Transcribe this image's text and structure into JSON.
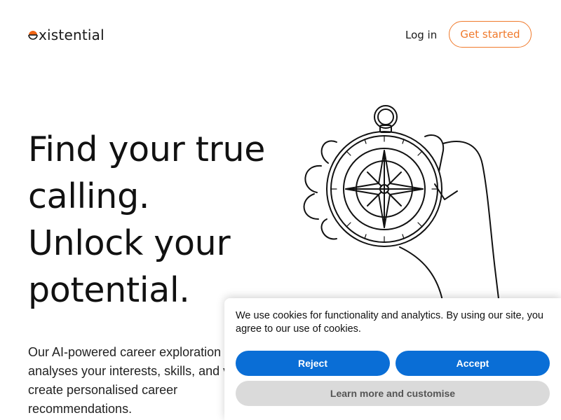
{
  "header": {
    "logo_text": "xistential",
    "logo_mark_color": "#f06414",
    "login_label": "Log in",
    "get_started_label": "Get started",
    "accent_color": "#f07a2c"
  },
  "hero": {
    "title_lines": [
      "Find your true",
      "calling.",
      "Unlock your",
      "potential."
    ],
    "description_lines": [
      "Our AI-powered career exploration t",
      "analyses your interests, skills, and v",
      "create personalised career",
      "recommendations."
    ],
    "illustration_icon": "hand-holding-compass-icon"
  },
  "cookie_banner": {
    "message": "We use cookies for functionality and analytics. By using our site, you agree to our use of cookies.",
    "reject_label": "Reject",
    "accept_label": "Accept",
    "learn_more_label": "Learn more and customise",
    "primary_button_color": "#0a6ed6",
    "secondary_button_color": "#dadada"
  }
}
